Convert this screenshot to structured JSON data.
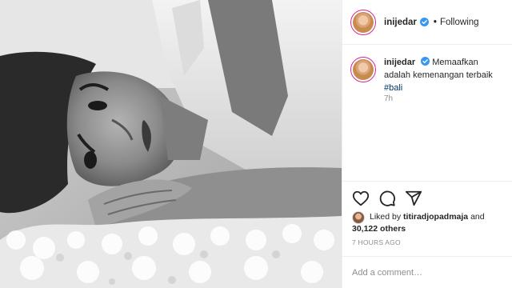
{
  "post": {
    "username": "inijedar",
    "follow_status": "Following",
    "separator": "•",
    "caption": {
      "username": "inijedar",
      "text": "Memaafkan adalah kemenangan terbaik",
      "hashtag": "#bali"
    },
    "caption_time": "7h",
    "likes": {
      "prefix": "Liked by",
      "first_liker": "titiradjopadmaja",
      "and": "and",
      "others": "30,122 others"
    },
    "posted_time": "7 HOURS AGO",
    "comment_placeholder": "Add a comment…"
  },
  "icons": {
    "verified": "verified-badge-icon",
    "like": "heart-icon",
    "comment": "speech-bubble-icon",
    "share": "paper-plane-icon"
  },
  "colors": {
    "verified_blue": "#3897f0",
    "hashtag": "#00376b",
    "muted_text": "#8e8e8e",
    "border": "#efefef"
  }
}
